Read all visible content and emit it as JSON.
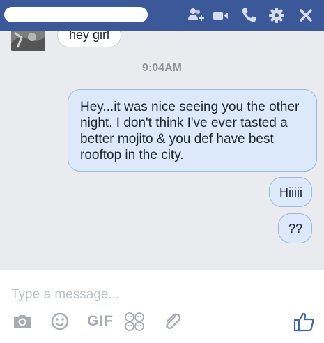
{
  "header": {
    "icons": [
      "add-person-icon",
      "video-camera-icon",
      "phone-icon",
      "gear-icon",
      "close-icon"
    ],
    "bg_color": "#3b5998"
  },
  "conversation": {
    "incoming": [
      {
        "text": "hey girl"
      }
    ],
    "timestamp": "9:04AM",
    "outgoing": [
      {
        "text": "Hey...it was nice seeing you the other night. I don't think I've ever tasted a better mojito & you def have best rooftop in the city."
      },
      {
        "text": "Hiiiii"
      },
      {
        "text": "??"
      }
    ]
  },
  "composer": {
    "placeholder": "Type a message...",
    "gif_label": "GIF",
    "tools": [
      "camera-icon",
      "emoji-icon",
      "gif-button",
      "stickers-icon",
      "attachment-icon",
      "like-icon"
    ],
    "accent_color": "#4267b2"
  }
}
